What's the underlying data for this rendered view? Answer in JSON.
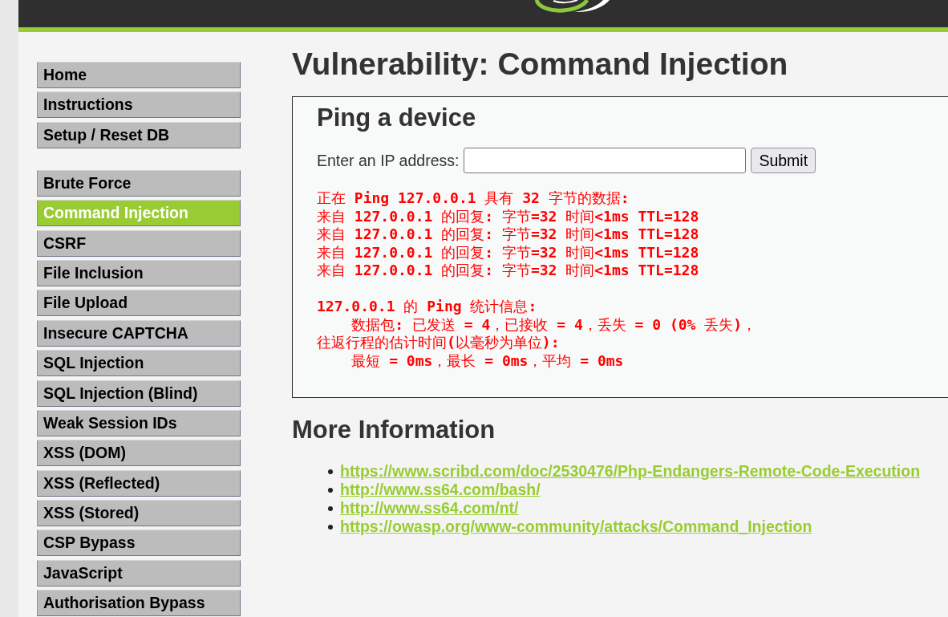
{
  "sidebar": {
    "groups": [
      {
        "items": [
          {
            "label": "Home",
            "selected": false
          },
          {
            "label": "Instructions",
            "selected": false
          },
          {
            "label": "Setup / Reset DB",
            "selected": false
          }
        ]
      },
      {
        "items": [
          {
            "label": "Brute Force",
            "selected": false
          },
          {
            "label": "Command Injection",
            "selected": true
          },
          {
            "label": "CSRF",
            "selected": false
          },
          {
            "label": "File Inclusion",
            "selected": false
          },
          {
            "label": "File Upload",
            "selected": false
          },
          {
            "label": "Insecure CAPTCHA",
            "selected": false
          },
          {
            "label": "SQL Injection",
            "selected": false
          },
          {
            "label": "SQL Injection (Blind)",
            "selected": false
          },
          {
            "label": "Weak Session IDs",
            "selected": false
          },
          {
            "label": "XSS (DOM)",
            "selected": false
          },
          {
            "label": "XSS (Reflected)",
            "selected": false
          },
          {
            "label": "XSS (Stored)",
            "selected": false
          },
          {
            "label": "CSP Bypass",
            "selected": false
          },
          {
            "label": "JavaScript",
            "selected": false
          },
          {
            "label": "Authorisation Bypass",
            "selected": false
          }
        ]
      }
    ]
  },
  "main": {
    "title": "Vulnerability: Command Injection",
    "panel": {
      "heading": "Ping a device",
      "ip_field": {
        "label": "Enter an IP address:"
      },
      "submit_button": "Submit",
      "output": [
        {
          "lines": [
            {
              "text": "正在 Ping 127.0.0.1 具有 32 字节的数据:",
              "indented": false
            },
            {
              "text": "来自 127.0.0.1 的回复: 字节=32 时间<1ms TTL=128",
              "indented": false
            },
            {
              "text": "来自 127.0.0.1 的回复: 字节=32 时间<1ms TTL=128",
              "indented": false
            },
            {
              "text": "来自 127.0.0.1 的回复: 字节=32 时间<1ms TTL=128",
              "indented": false
            },
            {
              "text": "来自 127.0.0.1 的回复: 字节=32 时间<1ms TTL=128",
              "indented": false
            }
          ]
        },
        {
          "lines": [
            {
              "text": "127.0.0.1 的 Ping 统计信息:",
              "indented": false
            },
            {
              "text": "数据包: 已发送 = 4，已接收 = 4，丢失 = 0 (0% 丢失)，",
              "indented": true
            },
            {
              "text": "往返行程的估计时间(以毫秒为单位):",
              "indented": false
            },
            {
              "text": "最短 = 0ms，最长 = 0ms，平均 = 0ms",
              "indented": true
            }
          ]
        }
      ]
    },
    "more_info": {
      "heading": "More Information",
      "links": [
        "https://www.scribd.com/doc/2530476/Php-Endangers-Remote-Code-Execution",
        "http://www.ss64.com/bash/",
        "http://www.ss64.com/nt/",
        "https://owasp.org/www-community/attacks/Command_Injection"
      ]
    }
  }
}
